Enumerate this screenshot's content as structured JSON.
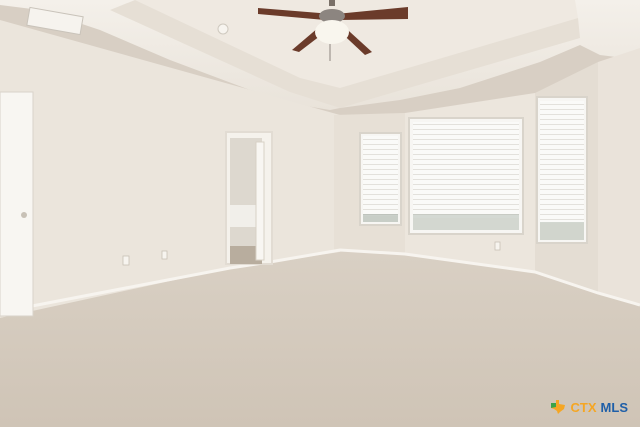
{
  "scene": {
    "subject": "empty-bedroom-interior",
    "colors": {
      "wall": "#ece6dd",
      "wall_shadow": "#e2dbd1",
      "ceiling": "#f2ede6",
      "carpet": "#d6ccbf",
      "trim": "#f7f4ef",
      "fan_blade": "#6b3b2a",
      "window_glow": "#f9f9f7"
    }
  },
  "watermark": {
    "brand_prefix": "CTX",
    "brand_suffix": "MLS",
    "icon": "texas-map-icon"
  }
}
